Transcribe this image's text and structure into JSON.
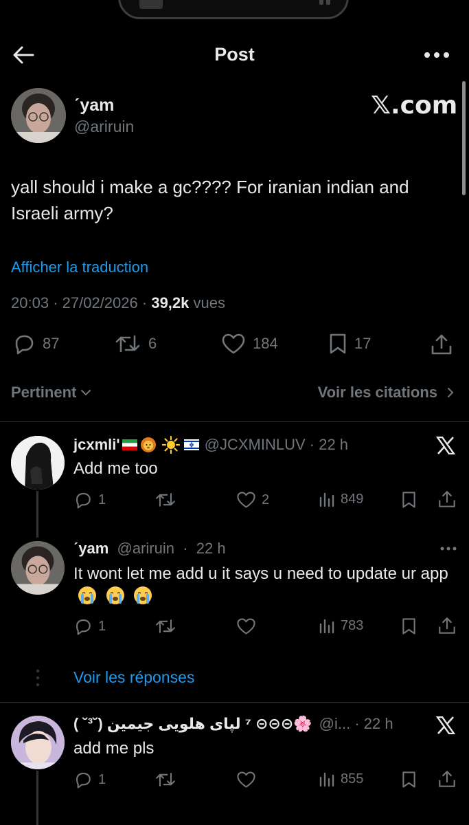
{
  "header": {
    "title": "Post"
  },
  "post": {
    "display_name": "ˊyam",
    "handle": "@ariruin",
    "source_badge": "𝕏.com",
    "text": "yall should i make a gc???? For iranian indian and Israeli army?",
    "translate_link": "Afficher la traduction",
    "time": "20:03",
    "date": "27/02/2026",
    "views_count": "39,2k",
    "views_label": "vues",
    "replies": "87",
    "reposts": "6",
    "likes": "184",
    "bookmarks": "17"
  },
  "sort_bar": {
    "filter_label": "Pertinent",
    "quotes_label": "Voir les citations"
  },
  "replies": [
    {
      "name": "jcxmli'",
      "name_emojis": [
        "iran-flag",
        "lion-face",
        "sun",
        "israel-flag"
      ],
      "handle": "@JCXMINLUV",
      "time": "22 h",
      "text": "Add me too",
      "replies": "1",
      "reposts": "",
      "likes": "2",
      "views": "849"
    },
    {
      "name": "ˊyam",
      "handle": "@ariruin",
      "time": "22 h",
      "text": "It wont let me add u it says u need to update ur app",
      "emojis": [
        "loudly-crying-face",
        "loudly-crying-face",
        "loudly-crying-face"
      ],
      "replies": "1",
      "reposts": "",
      "likes": "",
      "views": "783"
    },
    {
      "name": "🌸⊝⊝⊝ ⁷ لپای هلویی جیمین (˘³˘ )",
      "handle": "@i...",
      "time": "22 h",
      "text": "add me pls",
      "replies": "1",
      "reposts": "",
      "likes": "",
      "views": "855"
    }
  ],
  "thread": {
    "show_replies_label": "Voir les réponses"
  },
  "colors": {
    "background": "#000000",
    "text": "#e7e9ea",
    "muted": "#71767b",
    "link": "#1d9bf0",
    "divider": "#2f3336"
  }
}
